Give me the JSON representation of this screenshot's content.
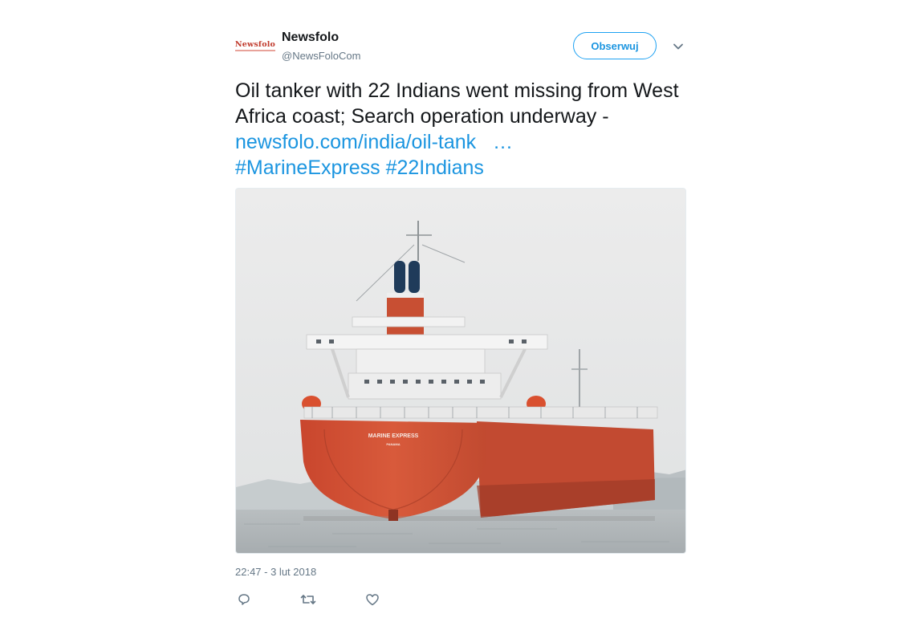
{
  "author": {
    "avatar_text": "Newsfolo",
    "name": "Newsfolo",
    "handle": "@NewsFoloCom"
  },
  "header": {
    "follow_label": "Obserwuj",
    "menu_icon": "chevron-down-icon"
  },
  "tweet": {
    "text_part1": "Oil tanker with 22 Indians went missing from West Africa coast; Search operation underway - ",
    "link": "newsfolo.com/india/oil-tank",
    "ellipsis": "…",
    "hashtag1": "#MarineExpress",
    "hashtag2": "#22Indians"
  },
  "media": {
    "hull_name": "MARINE EXPRESS",
    "hull_port": "PANAMA"
  },
  "timestamp": "22:47 - 3 lut 2018",
  "actions": {
    "reply_icon": "reply-icon",
    "retweet_icon": "retweet-icon",
    "like_icon": "heart-icon"
  },
  "colors": {
    "accent": "#1da1f2",
    "link": "#1b95e0",
    "secondary_text": "#657786",
    "hull": "#d2553a"
  }
}
